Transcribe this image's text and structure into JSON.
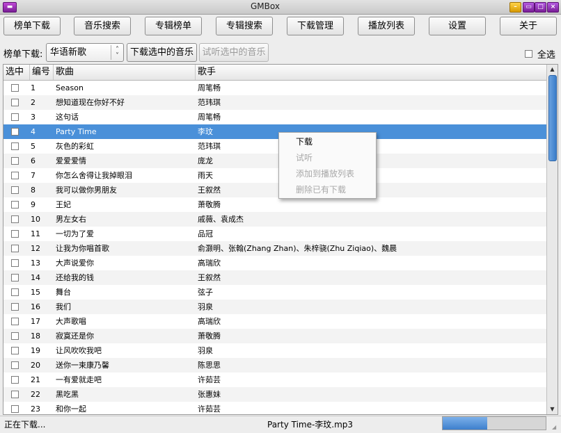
{
  "window": {
    "title": "GMBox",
    "menu_glyph": "▬"
  },
  "nav": [
    {
      "label": "榜单下载",
      "name": "nav-chart-download"
    },
    {
      "label": "音乐搜索",
      "name": "nav-music-search"
    },
    {
      "label": "专辑榜单",
      "name": "nav-album-chart"
    },
    {
      "label": "专辑搜索",
      "name": "nav-album-search"
    },
    {
      "label": "下载管理",
      "name": "nav-download-manager"
    },
    {
      "label": "播放列表",
      "name": "nav-playlist"
    },
    {
      "label": "设置",
      "name": "nav-settings"
    },
    {
      "label": "关于",
      "name": "nav-about"
    }
  ],
  "toolbar": {
    "chart_label": "榜单下载:",
    "chart_select": "华语新歌",
    "download_selected": "下载选中的音乐",
    "preview_selected": "试听选中的音乐",
    "select_all": "全选"
  },
  "table": {
    "columns": [
      "选中",
      "编号",
      "歌曲",
      "歌手"
    ],
    "selected_row": 4,
    "rows": [
      {
        "no": "1",
        "song": "Season",
        "artist": "周笔畅"
      },
      {
        "no": "2",
        "song": "想知道现在你好不好",
        "artist": "范玮琪"
      },
      {
        "no": "3",
        "song": "这句话",
        "artist": "周笔畅"
      },
      {
        "no": "4",
        "song": "Party Time",
        "artist": "李玟"
      },
      {
        "no": "5",
        "song": "灰色的彩虹",
        "artist": "范玮琪"
      },
      {
        "no": "6",
        "song": "爱爱爱情",
        "artist": "庞龙"
      },
      {
        "no": "7",
        "song": "你怎么舍得让我掉眼泪",
        "artist": "雨天"
      },
      {
        "no": "8",
        "song": "我可以做你男朋友",
        "artist": "王叙然"
      },
      {
        "no": "9",
        "song": "王妃",
        "artist": "萧敬腾"
      },
      {
        "no": "10",
        "song": "男左女右",
        "artist": "戚薇、袁成杰"
      },
      {
        "no": "11",
        "song": "一切为了爱",
        "artist": "品冠"
      },
      {
        "no": "12",
        "song": "让我为你唱首歌",
        "artist": "俞灏明、张翰(Zhang Zhan)、朱梓骁(Zhu Ziqiao)、魏晨"
      },
      {
        "no": "13",
        "song": "大声说爱你",
        "artist": "高瑞欣"
      },
      {
        "no": "14",
        "song": "还给我的钱",
        "artist": "王叙然"
      },
      {
        "no": "15",
        "song": "舞台",
        "artist": "弦子"
      },
      {
        "no": "16",
        "song": "我们",
        "artist": "羽泉"
      },
      {
        "no": "17",
        "song": "大声歌唱",
        "artist": "高瑞欣"
      },
      {
        "no": "18",
        "song": "寂寞还是你",
        "artist": "萧敬腾"
      },
      {
        "no": "19",
        "song": "让风吹吹我吧",
        "artist": "羽泉"
      },
      {
        "no": "20",
        "song": "送你一束康乃馨",
        "artist": "陈思思"
      },
      {
        "no": "21",
        "song": "一有爱就走吧",
        "artist": "许茹芸"
      },
      {
        "no": "22",
        "song": "黑吃黑",
        "artist": "张惠妹"
      },
      {
        "no": "23",
        "song": "和你一起",
        "artist": "许茹芸"
      }
    ]
  },
  "context_menu": [
    {
      "label": "下载",
      "enabled": true
    },
    {
      "label": "试听",
      "enabled": false
    },
    {
      "label": "添加到播放列表",
      "enabled": false
    },
    {
      "label": "删除已有下载",
      "enabled": false
    }
  ],
  "status": {
    "text": "正在下载...",
    "file": "Party Time-李玟.mp3",
    "progress": 0.43
  },
  "colors": {
    "selection": "#4a90d9",
    "accent": "#7a1e97"
  }
}
